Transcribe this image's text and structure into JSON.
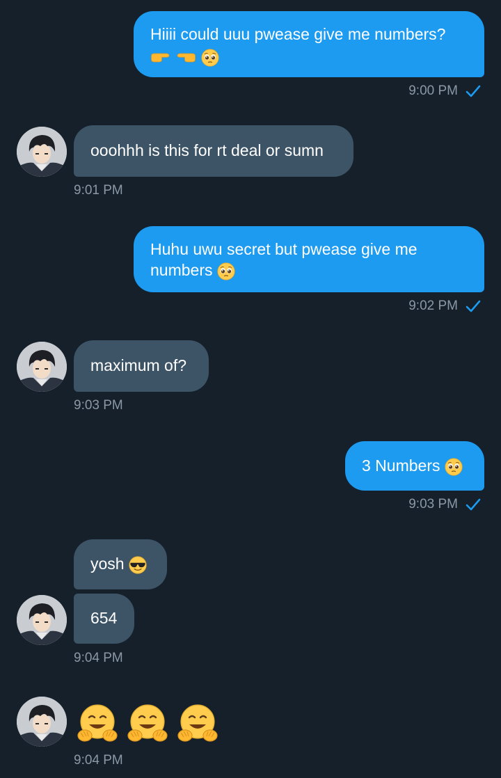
{
  "messages": [
    {
      "from": "me",
      "text": "Hiiii could uuu pwease give me numbers?",
      "emoji": [
        "point-right-icon",
        "point-left-icon",
        "pleading-face-icon"
      ],
      "time": "9:00 PM"
    },
    {
      "from": "them",
      "text": "ooohhh is this for rt deal or sumn",
      "time": "9:01 PM"
    },
    {
      "from": "me",
      "text_line1": "Huhu uwu secret but pwease give me",
      "text_line2": "numbers",
      "emoji": [
        "pleading-face-icon"
      ],
      "time": "9:02 PM"
    },
    {
      "from": "them",
      "text": "maximum of?",
      "time": "9:03 PM"
    },
    {
      "from": "me",
      "text": "3 Numbers",
      "emoji": [
        "pleading-face-icon"
      ],
      "time": "9:03 PM"
    },
    {
      "from": "them",
      "text": "yosh",
      "emoji": [
        "sunglasses-face-icon"
      ]
    },
    {
      "from": "them",
      "text": "654",
      "time": "9:04 PM"
    },
    {
      "from": "them",
      "emoji": [
        "hugging-face-icon",
        "hugging-face-icon",
        "hugging-face-icon"
      ],
      "time": "9:04 PM"
    }
  ],
  "colors": {
    "background": "#15202b",
    "outgoing": "#1d9bf0",
    "incoming": "#3d5467",
    "timestamp": "#8b98a5",
    "check": "#1d9bf0"
  }
}
